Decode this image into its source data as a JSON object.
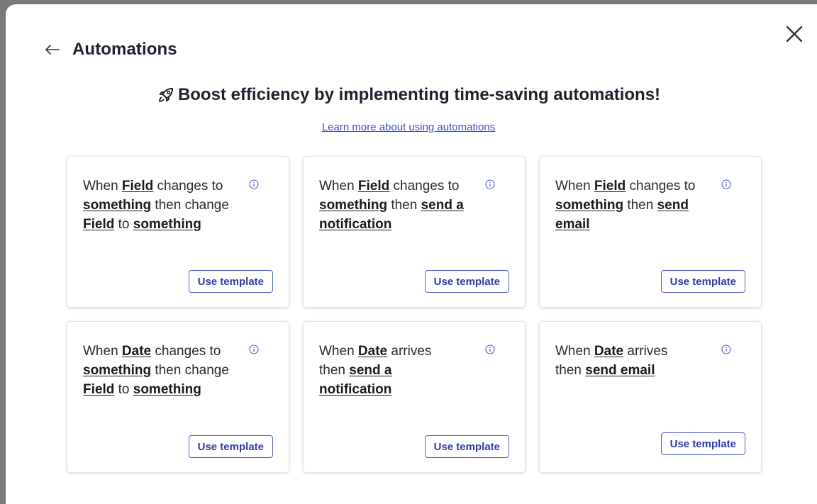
{
  "header": {
    "title": "Automations",
    "back_icon": "arrow-left-icon",
    "close_icon": "close-icon"
  },
  "hero": {
    "icon": "rocket-icon",
    "headline": "Boost efficiency by implementing time-saving automations!",
    "learn_more_link": "Learn more about using automations"
  },
  "colors": {
    "link": "#3d4fd1",
    "button_border": "#4f5bd5",
    "button_text": "#2f3aa8"
  },
  "templates": [
    {
      "segments": [
        {
          "text": "When ",
          "bold": false
        },
        {
          "text": "Field",
          "bold": true
        },
        {
          "text": " changes to ",
          "bold": false
        },
        {
          "text": "something",
          "bold": true
        },
        {
          "text": " then change ",
          "bold": false
        },
        {
          "text": "Field",
          "bold": true
        },
        {
          "text": " to ",
          "bold": false
        },
        {
          "text": "something",
          "bold": true
        }
      ],
      "button": "Use template"
    },
    {
      "segments": [
        {
          "text": "When ",
          "bold": false
        },
        {
          "text": "Field",
          "bold": true
        },
        {
          "text": " changes to ",
          "bold": false
        },
        {
          "text": "something",
          "bold": true
        },
        {
          "text": " then ",
          "bold": false
        },
        {
          "text": "send a notification",
          "bold": true
        }
      ],
      "button": "Use template"
    },
    {
      "segments": [
        {
          "text": "When ",
          "bold": false
        },
        {
          "text": "Field",
          "bold": true
        },
        {
          "text": " changes to ",
          "bold": false
        },
        {
          "text": "something",
          "bold": true
        },
        {
          "text": " then ",
          "bold": false
        },
        {
          "text": "send email",
          "bold": true
        }
      ],
      "button": "Use template"
    },
    {
      "segments": [
        {
          "text": "When ",
          "bold": false
        },
        {
          "text": "Date",
          "bold": true
        },
        {
          "text": " changes to ",
          "bold": false
        },
        {
          "text": "something",
          "bold": true
        },
        {
          "text": " then change ",
          "bold": false
        },
        {
          "text": "Field",
          "bold": true
        },
        {
          "text": " to ",
          "bold": false
        },
        {
          "text": "something",
          "bold": true
        }
      ],
      "button": "Use template"
    },
    {
      "segments": [
        {
          "text": "When ",
          "bold": false
        },
        {
          "text": "Date",
          "bold": true
        },
        {
          "text": " arrives then ",
          "bold": false
        },
        {
          "text": "send a notification",
          "bold": true
        }
      ],
      "button": "Use template"
    },
    {
      "segments": [
        {
          "text": "When ",
          "bold": false
        },
        {
          "text": "Date",
          "bold": true
        },
        {
          "text": " arrives then ",
          "bold": false
        },
        {
          "text": "send email",
          "bold": true
        }
      ],
      "button": "Use template"
    }
  ]
}
